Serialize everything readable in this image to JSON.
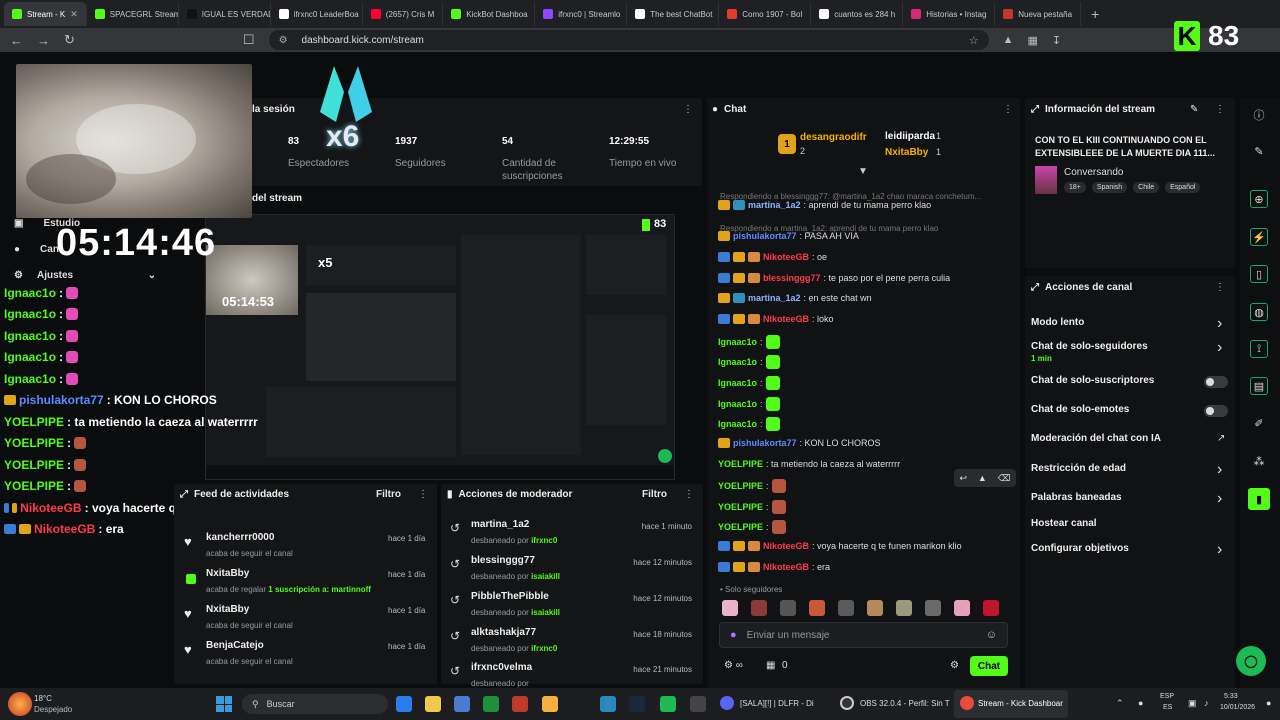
{
  "tabs": [
    {
      "label": "Stream - K",
      "color": "#53fc18",
      "active": true
    },
    {
      "label": "SPACEGRL Stream",
      "color": "#53fc18"
    },
    {
      "label": "IGUAL ES VERDAD",
      "color": "#111111"
    },
    {
      "label": "ifrxnc0 LeaderBoa",
      "color": "#ffffff"
    },
    {
      "label": "(2657) Cris M",
      "color": "#ff0033"
    },
    {
      "label": "KickBot Dashboa",
      "color": "#53fc18"
    },
    {
      "label": "ifrxnc0 | Streamlo",
      "color": "#9146ff"
    },
    {
      "label": "The best ChatBot",
      "color": "#ffffff"
    },
    {
      "label": "Como 1907 - Bol",
      "color": "#e33b2e"
    },
    {
      "label": "cuantos es 284 h",
      "color": "#ffffff"
    },
    {
      "label": "Historias • Instag",
      "color": "#d62976"
    },
    {
      "label": "Nueva pestaña",
      "color": "#c0392b"
    }
  ],
  "browser": {
    "url": "dashboard.kick.com/stream",
    "new_tab": "+"
  },
  "overlay": {
    "kick_letter": "K",
    "viewer_count": "83",
    "big_timer": "05:14:46",
    "small_timer": "05:14:53",
    "hand_multiplier": "x6",
    "preview_multiplier": "x5"
  },
  "session": {
    "title": "la sesión",
    "stats": [
      {
        "value": "83",
        "label": "Espectadores"
      },
      {
        "value": "1937",
        "label": "Seguidores"
      },
      {
        "value": "54",
        "label": "Cantidad de suscripciones"
      },
      {
        "value": "12:29:55",
        "label": "Tiempo en vivo"
      }
    ],
    "preview_title": "del stream"
  },
  "left_menu": {
    "items": [
      "Estudio",
      "Can",
      "Ajustes"
    ]
  },
  "left_chat": [
    {
      "user": "Ignaac1o",
      "msg": ":",
      "color": "#53fc18",
      "emote": true
    },
    {
      "user": "Ignaac1o",
      "msg": ":",
      "color": "#53fc18",
      "emote": true
    },
    {
      "user": "Ignaac1o",
      "msg": ":",
      "color": "#53fc18",
      "emote": true
    },
    {
      "user": "Ignaac1o",
      "msg": ":",
      "color": "#53fc18",
      "emote": true
    },
    {
      "user": "Ignaac1o",
      "msg": ":",
      "color": "#53fc18",
      "emote": true
    },
    {
      "user": "pishulakorta77",
      "msg": ": KON LO CHOROS",
      "color": "#5b8cff",
      "emote": false
    },
    {
      "user": "YOELPIPE",
      "msg": ": ta metiendo la caeza al waterrrrr",
      "color": "#53fc18",
      "emote": false
    },
    {
      "user": "YOELPIPE",
      "msg": ":",
      "color": "#53fc18",
      "emote": true
    },
    {
      "user": "YOELPIPE",
      "msg": ":",
      "color": "#53fc18",
      "emote": true
    },
    {
      "user": "YOELPIPE",
      "msg": ":",
      "color": "#53fc18",
      "emote": true
    },
    {
      "user": "NikoteeGB",
      "msg": ": voya hacerte q te funen marikon klio",
      "color": "#ff3b4e",
      "emote": false
    },
    {
      "user": "NikoteeGB",
      "msg": ": era",
      "color": "#ff3b4e",
      "emote": false
    }
  ],
  "feed": {
    "title": "Feed de actividades",
    "filter": "Filtro",
    "items": [
      {
        "name": "kancherrr0000",
        "sub": "acaba de seguir el canal",
        "extra": "",
        "time": "hace 1 día",
        "icon": "heart"
      },
      {
        "name": "NxitaBby",
        "sub": "acaba de regalar",
        "extra": "1 suscripción a: martinnoff",
        "time": "hace 1 día",
        "icon": "gift"
      },
      {
        "name": "NxitaBby",
        "sub": "acaba de seguir el canal",
        "extra": "",
        "time": "hace 1 día",
        "icon": "heart"
      },
      {
        "name": "BenjaCatejo",
        "sub": "acaba de seguir el canal",
        "extra": "",
        "time": "hace 1 día",
        "icon": "heart"
      }
    ]
  },
  "moderation": {
    "title": "Acciones de moderador",
    "filter": "Filtro",
    "items": [
      {
        "name": "martina_1a2",
        "sub": "desbaneado por",
        "by": "ifrxnc0",
        "time": "hace 1 minuto"
      },
      {
        "name": "blessinggg77",
        "sub": "desbaneado por",
        "by": "isaiakill",
        "time": "hace 12 minutos"
      },
      {
        "name": "PibbleThePibble",
        "sub": "desbaneado por",
        "by": "isaiakill",
        "time": "hace 12 minutos"
      },
      {
        "name": "alktashakja77",
        "sub": "desbaneado por",
        "by": "ifrxnc0",
        "time": "hace 18 minutos"
      },
      {
        "name": "ifrxnc0velma",
        "sub": "desbaneado por",
        "by": "",
        "time": "hace 21 minutos"
      }
    ]
  },
  "chat": {
    "title": "Chat",
    "top_gifters": [
      {
        "rank": "1",
        "name": "desangraodifr",
        "count": "2"
      },
      {
        "name": "leidiiparda",
        "count": "1"
      },
      {
        "name": "NxitaBby",
        "count": "1"
      }
    ],
    "messages": [
      {
        "reply": "Respondiendo a blessinggg77: @martina_1a2 chao maraca conchetum...",
        "user": "martina_1a2",
        "msg": ": aprendi de tu mama perro klao",
        "color": "#8fb3ff"
      },
      {
        "reply": "Respondiendo a martina_1a2: aprendi de tu mama perro klao",
        "user": "pishulakorta77",
        "msg": ": PASA AH VIA",
        "color": "#5b8cff"
      },
      {
        "user": "NikoteeGB",
        "msg": ": oe",
        "color": "#ff3b4e"
      },
      {
        "user": "blessinggg77",
        "msg": ": te paso por el pene perra culia",
        "color": "#ff3b4e"
      },
      {
        "user": "martina_1a2",
        "msg": ": en este chat wn",
        "color": "#8fb3ff"
      },
      {
        "user": "NikoteeGB",
        "msg": ": loko",
        "color": "#ff3b4e"
      },
      {
        "user": "Ignaac1o",
        "msg": ":",
        "color": "#53fc18"
      },
      {
        "user": "Ignaac1o",
        "msg": ":",
        "color": "#53fc18"
      },
      {
        "user": "Ignaac1o",
        "msg": ":",
        "color": "#53fc18"
      },
      {
        "user": "Ignaac1o",
        "msg": ":",
        "color": "#53fc18"
      },
      {
        "user": "Ignaac1o",
        "msg": ":",
        "color": "#53fc18"
      },
      {
        "user": "pishulakorta77",
        "msg": ": KON LO CHOROS",
        "color": "#5b8cff"
      },
      {
        "user": "YOELPIPE",
        "msg": ": ta metiendo la caeza al waterrrrr",
        "color": "#53fc18"
      },
      {
        "user": "YOELPIPE",
        "msg": ":",
        "color": "#53fc18"
      },
      {
        "user": "YOELPIPE",
        "msg": ":",
        "color": "#53fc18"
      },
      {
        "user": "YOELPIPE",
        "msg": ":",
        "color": "#53fc18"
      },
      {
        "user": "NikoteeGB",
        "msg": ": voya hacerte q te funen marikon klio",
        "color": "#ff3b4e"
      },
      {
        "user": "NikoteeGB",
        "msg": ": era",
        "color": "#ff3b4e"
      }
    ],
    "mode": "Solo seguidores",
    "input_placeholder": "Enviar un mensaje",
    "points": "0",
    "send_label": "Chat"
  },
  "stream_info": {
    "title": "Información del stream",
    "stream_title": "CON TO EL KIII CONTINUANDO CON EL EXTENSIBLEEE DE LA MUERTE DIA 111...",
    "category": "Conversando",
    "tags": [
      "18+",
      "Spanish",
      "Chile",
      "Español"
    ]
  },
  "channel_actions": {
    "title": "Acciones de canal",
    "items": [
      {
        "label": "Modo lento",
        "control": "chevron"
      },
      {
        "label": "Chat de solo-seguidores",
        "sub": "1 min",
        "control": "chevron"
      },
      {
        "label": "Chat de solo-suscriptores",
        "control": "toggle"
      },
      {
        "label": "Chat de solo-emotes",
        "control": "toggle"
      },
      {
        "label": "Moderación del chat con IA",
        "control": "external"
      },
      {
        "label": "Restricción de edad",
        "control": "chevron"
      },
      {
        "label": "Palabras baneadas",
        "control": "chevron"
      },
      {
        "label": "Hostear canal",
        "control": "none"
      },
      {
        "label": "Configurar objetivos",
        "control": "chevron"
      }
    ]
  },
  "taskbar": {
    "weather_temp": "18°C",
    "weather_desc": "Despejado",
    "search": "Buscar",
    "apps": [
      "[SALA][!] | DLFR - Di",
      "OBS 32.0.4 - Perfil: Sin T",
      "Stream - Kick Dashboar"
    ],
    "lang": "ESP",
    "region": "ES",
    "time": "5:33",
    "date": "10/01/2026"
  },
  "colors": {
    "accent": "#53fc18",
    "red": "#ff3b4e",
    "blue": "#5b8cff"
  }
}
